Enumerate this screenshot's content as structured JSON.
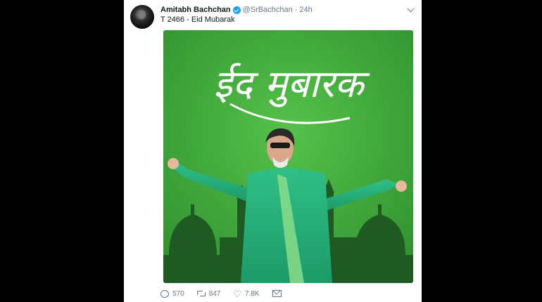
{
  "tweet": {
    "author_name": "Amitabh Bachchan",
    "handle": "@SrBachchan",
    "separator": "·",
    "time": "24h",
    "text": "T 2466 - Eid Mubarak"
  },
  "media": {
    "greeting_text": "ईद मुबारक",
    "background_color": "#3aa23a",
    "foreground_color": "#1f5a22"
  },
  "actions": {
    "replies": "570",
    "retweets": "847",
    "likes": "7.8K"
  },
  "colors": {
    "page_background": "#000000",
    "card_background": "#ffffff",
    "verified_badge": "#1da1f2",
    "muted_text": "#657786"
  }
}
